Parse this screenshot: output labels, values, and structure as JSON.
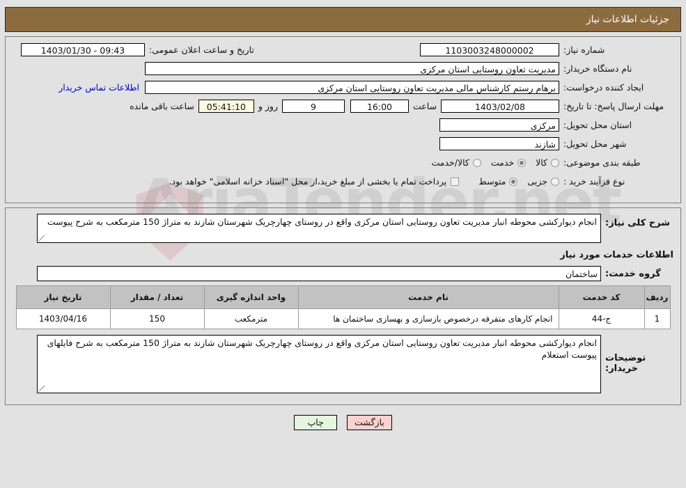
{
  "header": {
    "title": "جزئیات اطلاعات نیاز"
  },
  "colors": {
    "header_bg": "#8c6b3f",
    "page_bg": "#e2e2e2",
    "link": "#0000cc",
    "countdown_bg": "#fbfbe4",
    "table_header_bg": "#c2c2c2",
    "back_button_bg": "#ffd0d0",
    "print_button_bg": "#e4f6e0"
  },
  "form": {
    "need_number_label": "شماره نیاز:",
    "need_number_value": "1103003248000002",
    "public_announce_label": "تاریخ و ساعت اعلان عمومی:",
    "public_announce_value": "1403/01/30 - 09:43",
    "buyer_org_label": "نام دستگاه خریدار:",
    "buyer_org_value": "مدیریت تعاون روستایی استان مرکزی",
    "creator_label": "ایجاد کننده درخواست:",
    "creator_value": "برهام رستم کارشناس مالی مدیریت تعاون روستایی استان مرکزی",
    "contact_link": "اطلاعات تماس خریدار",
    "deadline_label": "مهلت ارسال پاسخ: تا تاریخ:",
    "deadline_date": "1403/02/08",
    "deadline_hour_label": "ساعت",
    "deadline_hour": "16:00",
    "remaining_days": "9",
    "days_and_label": "روز و",
    "countdown": "05:41:10",
    "remaining_hours_label": "ساعت باقی مانده",
    "province_label": "استان محل تحویل:",
    "province_value": "مرکزی",
    "city_label": "شهر محل تحویل:",
    "city_value": "شازند",
    "category_label": "طبقه بندی موضوعی:",
    "category_options": [
      {
        "label": "کالا",
        "selected": false
      },
      {
        "label": "خدمت",
        "selected": true
      },
      {
        "label": "کالا/خدمت",
        "selected": false
      }
    ],
    "purchase_type_label": "نوع فرآیند خرید :",
    "purchase_type_options": [
      {
        "label": "جزیی",
        "selected": false
      },
      {
        "label": "متوسط",
        "selected": true
      }
    ],
    "treasury_checkbox_checked": false,
    "treasury_note": "پرداخت تمام یا بخشی از مبلغ خرید،از محل \"اسناد خزانه اسلامی\" خواهد بود."
  },
  "need_summary": {
    "label": "شرح کلی نیاز:",
    "value": "انجام دیوارکشی محوطه انبار مدیریت تعاون روستایی استان مرکزی واقع در روستای چهارچریک شهرستان شازند به متراژ 150 مترمکعب به شرح پیوست"
  },
  "services": {
    "section_title": "اطلاعات خدمات مورد نیاز",
    "group_label": "گروه خدمت:",
    "group_value": "ساختمان",
    "columns": [
      "ردیف",
      "کد خدمت",
      "نام خدمت",
      "واحد اندازه گیری",
      "تعداد / مقدار",
      "تاریخ نیاز"
    ],
    "rows": [
      {
        "index": "1",
        "code": "ج-44",
        "name": "انجام کارهای متفرقه درخصوص بازسازی و بهسازی ساختمان ها",
        "unit": "مترمکعب",
        "quantity": "150",
        "need_date": "1403/04/16"
      }
    ]
  },
  "buyer_notes": {
    "label": "توضیحات خریدار:",
    "value": "انجام دیوارکشی محوطه انبار مدیریت تعاون روستایی استان مرکزی واقع در روستای چهارچریک شهرستان شازند به متراژ 150 مترمکعب به شرح فایلهای پیوست استعلام"
  },
  "buttons": {
    "print": "چاپ",
    "back": "بازگشت"
  },
  "watermark": {
    "text": "AriaTender.net"
  }
}
